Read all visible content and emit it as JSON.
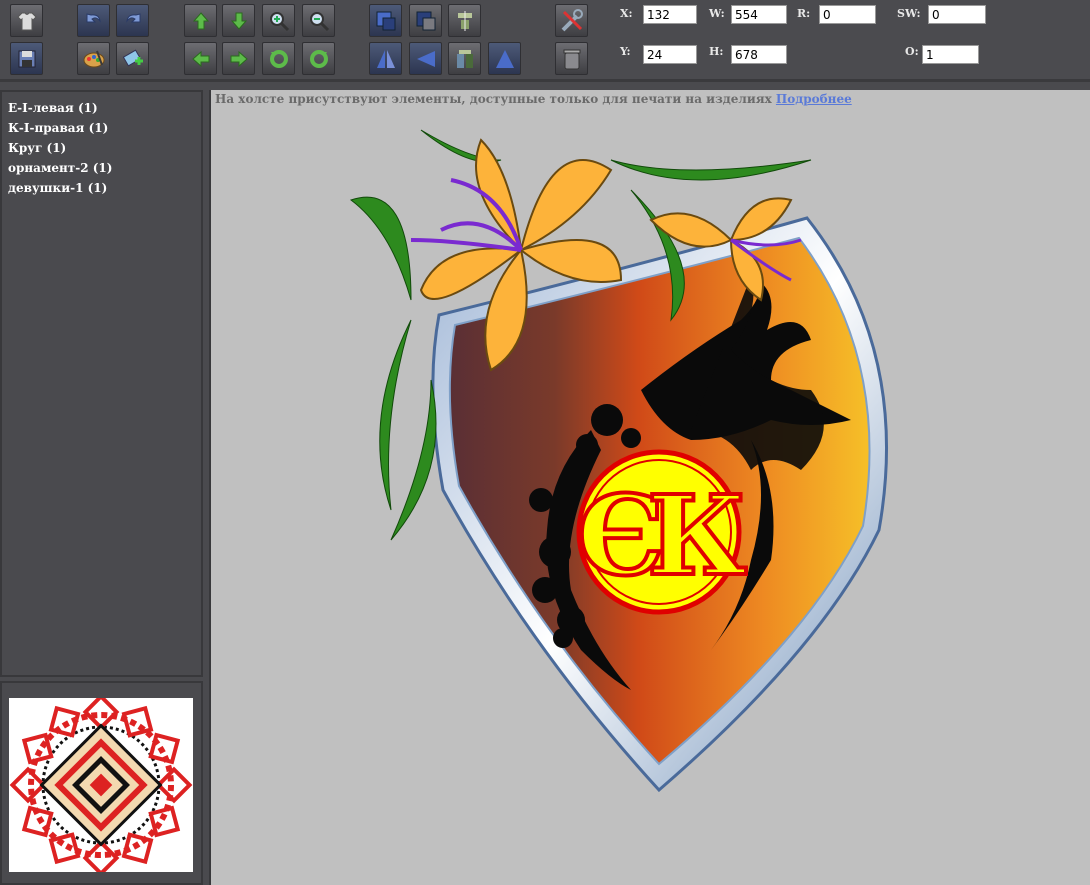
{
  "toolbar": {
    "x_label": "X:",
    "x_value": "132",
    "y_label": "Y:",
    "y_value": "24",
    "w_label": "W:",
    "w_value": "554",
    "h_label": "H:",
    "h_value": "678",
    "r_label": "R:",
    "r_value": "0",
    "sw_label": "SW:",
    "sw_value": "0",
    "o_label": "O:",
    "o_value": "1"
  },
  "layers": [
    {
      "label": "Е-I-левая (1)"
    },
    {
      "label": "К-I-правая (1)"
    },
    {
      "label": "Круг (1)"
    },
    {
      "label": "орнамент-2 (1)"
    },
    {
      "label": "девушки-1 (1)"
    }
  ],
  "notice": {
    "text": "На холсте присутствуют элементы, доступные только для печати на изделиях",
    "link": "Подробнее"
  },
  "artwork": {
    "monogram_left": "Є",
    "monogram_right": "К",
    "colors": {
      "shield_dark": "#6b3a3a",
      "shield_mid": "#d8501a",
      "shield_light": "#f4b62a",
      "flower": "#fdb33a",
      "monogram_fill": "#ffff00",
      "monogram_ring": "#e00000",
      "leaf": "#2d8a1e"
    }
  }
}
